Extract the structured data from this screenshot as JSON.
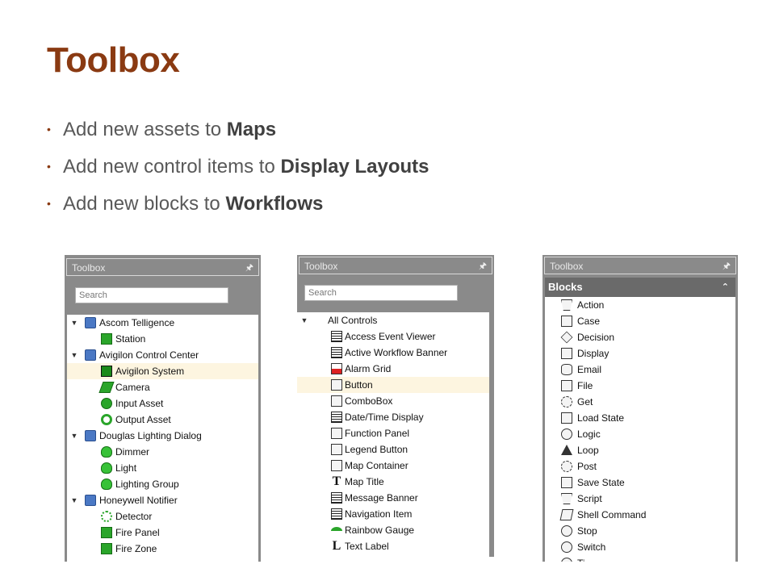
{
  "slide": {
    "title": "Toolbox",
    "bullets": [
      {
        "text": "Add new assets to ",
        "bold": "Maps"
      },
      {
        "text": "Add new control items to ",
        "bold": "Display Layouts"
      },
      {
        "text": "Add new blocks to ",
        "bold": "Workflows"
      }
    ],
    "accent_color": "#8a3a12"
  },
  "panel_maps": {
    "header": "Toolbox",
    "search_placeholder": "Search",
    "rows": [
      {
        "label": "Ascom Telligence",
        "icon": "building-icon",
        "level": 0,
        "expanded": true
      },
      {
        "label": "Station",
        "icon": "station-icon",
        "level": 1
      },
      {
        "label": "Avigilon Control Center",
        "icon": "building-icon",
        "level": 0,
        "expanded": true
      },
      {
        "label": "Avigilon System",
        "icon": "monitor-icon",
        "level": 1,
        "selected": true
      },
      {
        "label": "Camera",
        "icon": "camera-icon",
        "level": 1
      },
      {
        "label": "Input Asset",
        "icon": "input-icon",
        "level": 1
      },
      {
        "label": "Output Asset",
        "icon": "output-icon",
        "level": 1
      },
      {
        "label": "Douglas Lighting Dialog",
        "icon": "building-icon",
        "level": 0,
        "expanded": true
      },
      {
        "label": "Dimmer",
        "icon": "bulb-icon",
        "level": 1
      },
      {
        "label": "Light",
        "icon": "bulb-icon",
        "level": 1
      },
      {
        "label": "Lighting Group",
        "icon": "bulb-icon",
        "level": 1
      },
      {
        "label": "Honeywell Notifier",
        "icon": "building-icon",
        "level": 0,
        "expanded": true
      },
      {
        "label": "Detector",
        "icon": "biohazard-icon",
        "level": 1
      },
      {
        "label": "Fire Panel",
        "icon": "fire-panel-icon",
        "level": 1
      },
      {
        "label": "Fire Zone",
        "icon": "fire-zone-icon",
        "level": 1
      }
    ]
  },
  "panel_layouts": {
    "header": "Toolbox",
    "search_placeholder": "Search",
    "group_label": "All Controls",
    "rows": [
      {
        "label": "Access Event Viewer",
        "icon": "event-viewer-icon"
      },
      {
        "label": "Active Workflow Banner",
        "icon": "grid-icon"
      },
      {
        "label": "Alarm Grid",
        "icon": "alarm-grid-icon"
      },
      {
        "label": "Button",
        "icon": "button-icon",
        "selected": true
      },
      {
        "label": "ComboBox",
        "icon": "combobox-icon"
      },
      {
        "label": "Date/Time Display",
        "icon": "calendar-icon"
      },
      {
        "label": "Function Panel",
        "icon": "panel-icon"
      },
      {
        "label": "Legend Button",
        "icon": "legend-button-icon"
      },
      {
        "label": "Map Container",
        "icon": "map-container-icon"
      },
      {
        "label": "Map Title",
        "icon": "title-icon"
      },
      {
        "label": "Message Banner",
        "icon": "grid-icon"
      },
      {
        "label": "Navigation Item",
        "icon": "navigation-icon"
      },
      {
        "label": "Rainbow Gauge",
        "icon": "gauge-icon"
      },
      {
        "label": "Text Label",
        "icon": "text-label-icon"
      }
    ]
  },
  "panel_workflows": {
    "header": "Toolbox",
    "section_label": "Blocks",
    "rows": [
      {
        "label": "Action",
        "icon": "action-icon"
      },
      {
        "label": "Case",
        "icon": "case-icon"
      },
      {
        "label": "Decision",
        "icon": "decision-icon"
      },
      {
        "label": "Display",
        "icon": "display-icon"
      },
      {
        "label": "Email",
        "icon": "email-icon"
      },
      {
        "label": "File",
        "icon": "file-icon"
      },
      {
        "label": "Get",
        "icon": "get-icon"
      },
      {
        "label": "Load State",
        "icon": "load-state-icon"
      },
      {
        "label": "Logic",
        "icon": "logic-icon"
      },
      {
        "label": "Loop",
        "icon": "loop-icon"
      },
      {
        "label": "Post",
        "icon": "post-icon"
      },
      {
        "label": "Save State",
        "icon": "save-state-icon"
      },
      {
        "label": "Script",
        "icon": "script-icon"
      },
      {
        "label": "Shell Command",
        "icon": "shell-command-icon"
      },
      {
        "label": "Stop",
        "icon": "stop-icon"
      },
      {
        "label": "Switch",
        "icon": "switch-icon"
      },
      {
        "label": "Ti",
        "icon": "timer-icon"
      }
    ]
  }
}
